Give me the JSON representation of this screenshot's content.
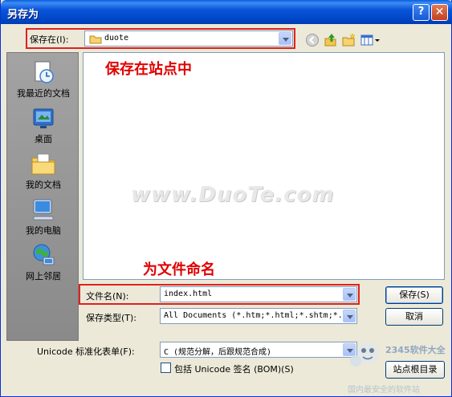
{
  "window": {
    "title": "另存为"
  },
  "toolbar": {
    "save_in_label": "保存在(I):",
    "save_in_value": "duote"
  },
  "annotations": {
    "save_in_site": "保存在站点中",
    "name_file": "为文件命名"
  },
  "places": [
    {
      "label": "我最近的文档",
      "icon": "recent-documents-icon"
    },
    {
      "label": "桌面",
      "icon": "desktop-icon"
    },
    {
      "label": "我的文档",
      "icon": "my-documents-icon"
    },
    {
      "label": "我的电脑",
      "icon": "my-computer-icon"
    },
    {
      "label": "网上邻居",
      "icon": "network-places-icon"
    }
  ],
  "watermark": "www.DuoTe.com",
  "form": {
    "filename_label": "文件名(N):",
    "filename_value": "index.html",
    "filetype_label": "保存类型(T):",
    "filetype_value": "All Documents (*.htm;*.html;*.shtm;*.",
    "unicode_label": "Unicode 标准化表单(F):",
    "unicode_value": "C (规范分解，后跟规范合成)",
    "bom_label": "包括 Unicode 签名 (BOM)(S)"
  },
  "buttons": {
    "save": "保存(S)",
    "cancel": "取消",
    "site_root": "站点根目录"
  },
  "branding": {
    "brand_text": "2345软件大全",
    "brand_subtext": "国内最安全的软件站"
  }
}
